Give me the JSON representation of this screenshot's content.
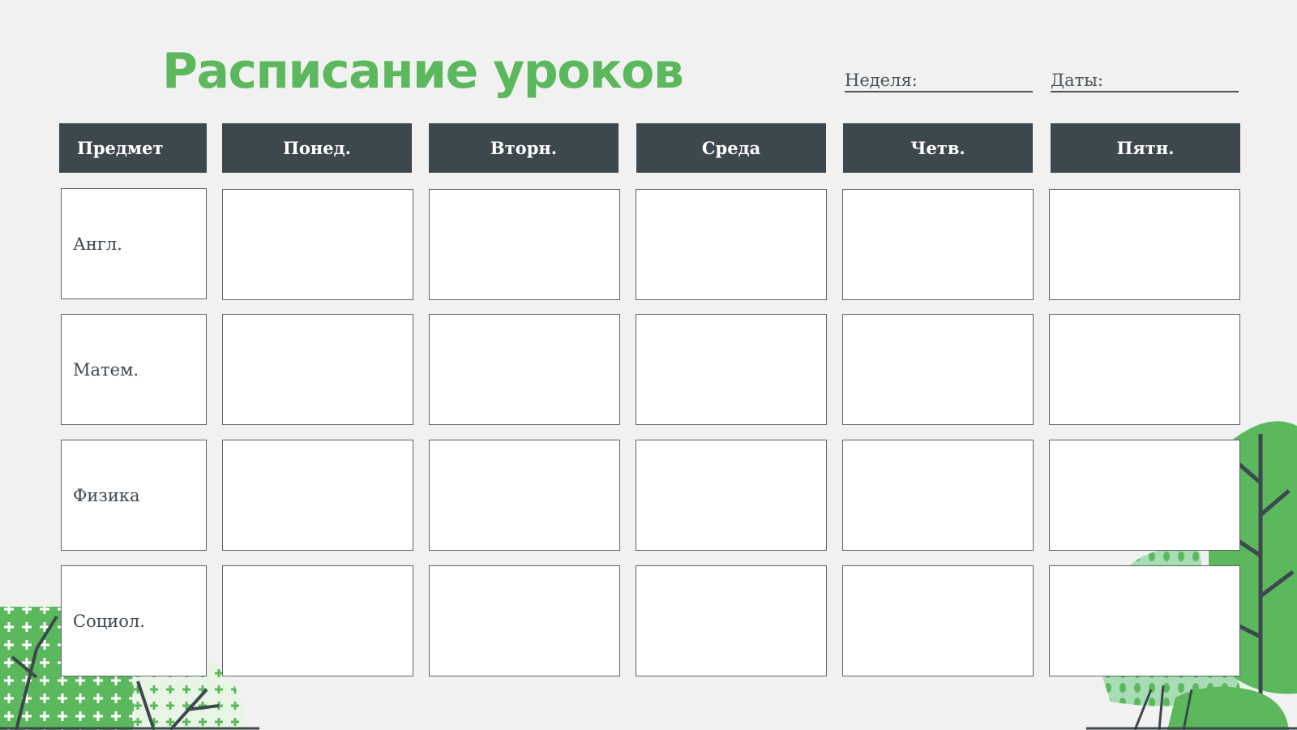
{
  "title": "Расписание уроков",
  "fields": {
    "week_label": "Неделя:",
    "dates_label": "Даты:"
  },
  "table": {
    "headers": [
      "Предмет",
      "Понед.",
      "Вторн.",
      "Среда",
      "Четв.",
      "Пятн."
    ],
    "subjects": [
      "Англ.",
      "Матем.",
      "Физика",
      "Социол."
    ]
  },
  "colors": {
    "title_green": "#5cb85c",
    "header_dark": "#3d474e",
    "background": "#f1f1f1"
  }
}
